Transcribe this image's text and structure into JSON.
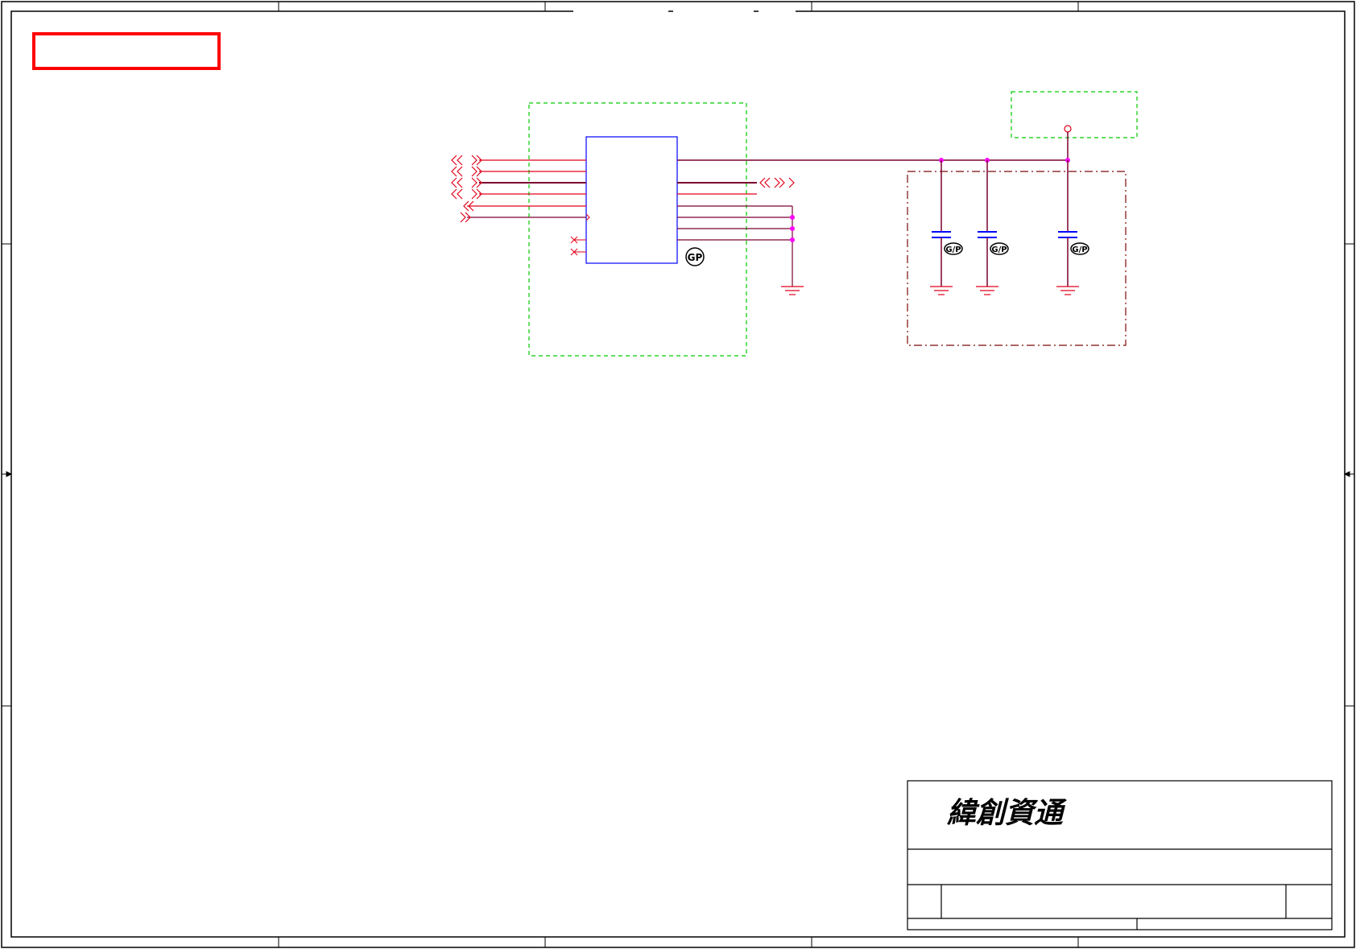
{
  "title_block": {
    "company_logo": "緯創資通"
  },
  "chip": {
    "marking": "GP"
  },
  "capacitors": [
    {
      "marking": "G/P"
    },
    {
      "marking": "G/P"
    },
    {
      "marking": "G/P"
    }
  ],
  "colors": {
    "wire": "#e0001a",
    "bus": "#7a0030",
    "component": "#0000ff",
    "junction": "#ff00ff",
    "group_box": "#00cc00",
    "shield_box": "#7a0a0a",
    "border": "#000000",
    "title_stamp": "#ff0000"
  }
}
